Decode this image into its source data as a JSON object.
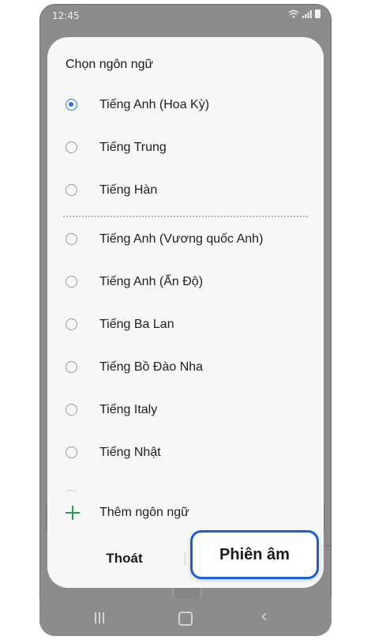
{
  "status_bar": {
    "time": "12:45",
    "icons": [
      "wifi-icon",
      "signal-icon",
      "battery-icon"
    ]
  },
  "dialog": {
    "title": "Chọn ngôn ngữ",
    "languages": [
      {
        "label": "Tiếng Anh (Hoa Kỳ)",
        "selected": true
      },
      {
        "label": "Tiếng Trung",
        "selected": false
      },
      {
        "label": "Tiếng Hàn",
        "selected": false
      },
      {
        "label": "Tiếng Anh (Vương quốc Anh)",
        "selected": false
      },
      {
        "label": "Tiếng Anh (Ấn Độ)",
        "selected": false
      },
      {
        "label": "Tiếng Ba Lan",
        "selected": false
      },
      {
        "label": "Tiếng Bồ Đào Nha",
        "selected": false
      },
      {
        "label": "Tiếng Italy",
        "selected": false
      },
      {
        "label": "Tiếng Nhật",
        "selected": false
      }
    ],
    "add_language": "Thêm ngôn ngữ",
    "exit_button": "Thoát",
    "transcribe_button": "Phiên âm"
  },
  "colors": {
    "accent": "#2a73e8",
    "highlight_border": "#1b5ed8",
    "add_icon": "#2f9a52"
  }
}
